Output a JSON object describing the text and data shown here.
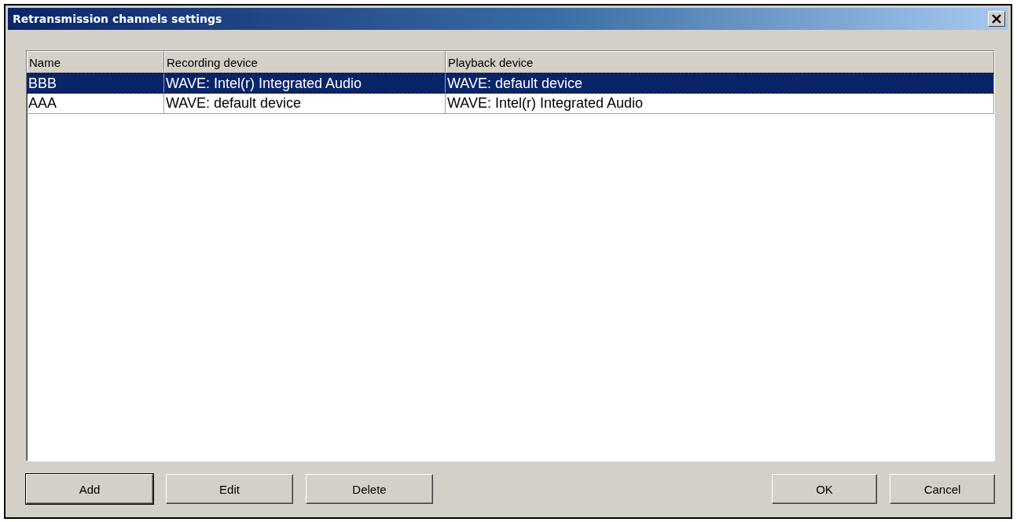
{
  "window": {
    "title": "Retransmission channels settings"
  },
  "table": {
    "columns": [
      "Name",
      "Recording device",
      "Playback device"
    ],
    "rows": [
      {
        "cells": [
          "BBB",
          "WAVE: Intel(r) Integrated Audio",
          "WAVE: default device"
        ],
        "selected": true
      },
      {
        "cells": [
          "AAA",
          "WAVE: default device",
          "WAVE: Intel(r) Integrated Audio"
        ],
        "selected": false
      }
    ]
  },
  "left_buttons": [
    {
      "label": "Add",
      "default": true
    },
    {
      "label": "Edit",
      "default": false
    },
    {
      "label": "Delete",
      "default": false
    }
  ],
  "right_buttons": [
    {
      "label": "OK",
      "default": false
    },
    {
      "label": "Cancel",
      "default": false
    }
  ]
}
